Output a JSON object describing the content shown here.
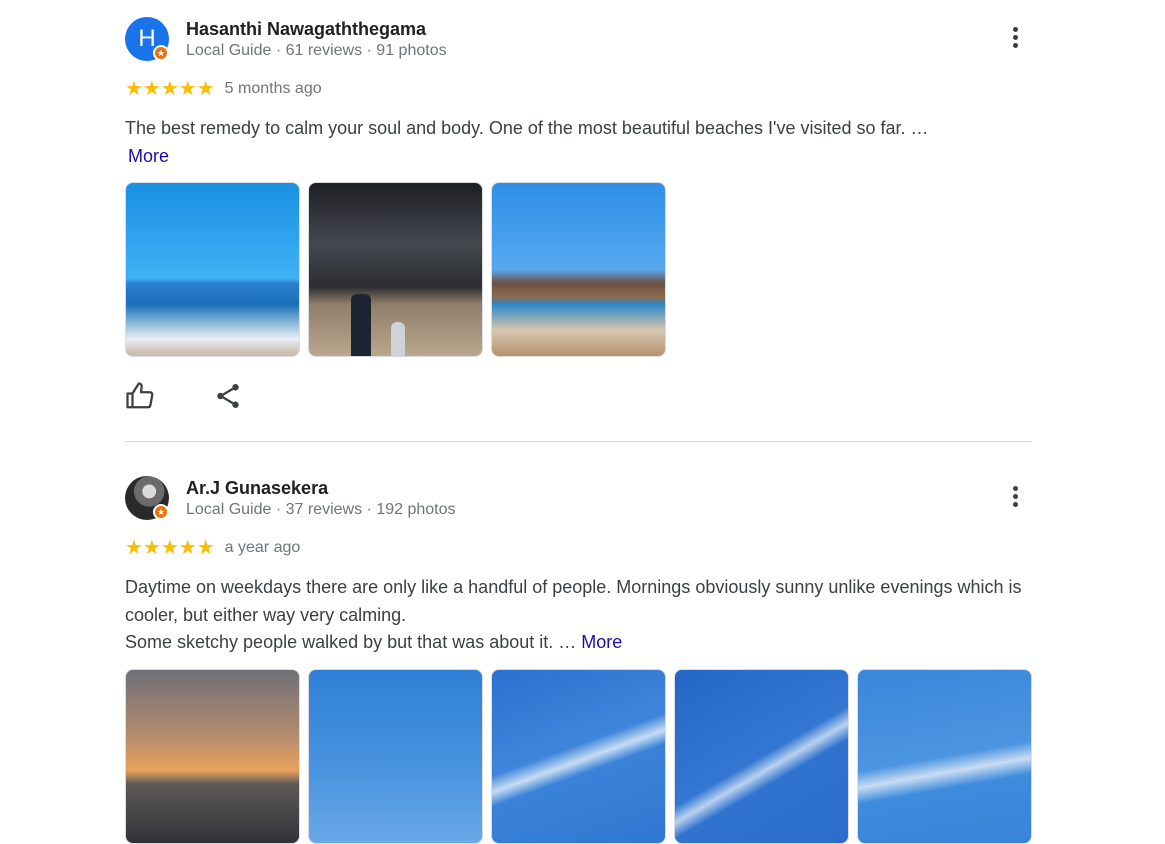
{
  "reviews": [
    {
      "reviewer_name": "Hasanthi Nawagaththegama",
      "avatar_letter": "H",
      "meta": "Local Guide · 61 reviews · 91 photos",
      "rating_stars": "★★★★★",
      "rating": 5,
      "time": "5 months ago",
      "text": "The best remedy to calm your soul and body. One of the most beautiful beaches I've visited so far. …",
      "more_label": "More",
      "photo_count": 3
    },
    {
      "reviewer_name": "Ar.J Gunasekera",
      "meta": "Local Guide · 37 reviews · 192 photos",
      "rating_stars": "★★★★★",
      "rating": 5,
      "time": "a year ago",
      "text_line1": "Daytime on weekdays there are only like a handful of people. Mornings obviously sunny unlike evenings which is cooler, but either way very calming.",
      "text_line2": "Some sketchy people walked by but that was about it. …",
      "more_label": "More",
      "photo_count": 5
    }
  ],
  "icons": {
    "like": "thumbs-up-icon",
    "share": "share-icon",
    "menu": "more-vert-icon",
    "badge": "local-guide-badge-icon"
  },
  "colors": {
    "star": "#fbbc04",
    "link": "#1a0dab",
    "avatar": "#1a73e8",
    "badge": "#e8710a"
  }
}
